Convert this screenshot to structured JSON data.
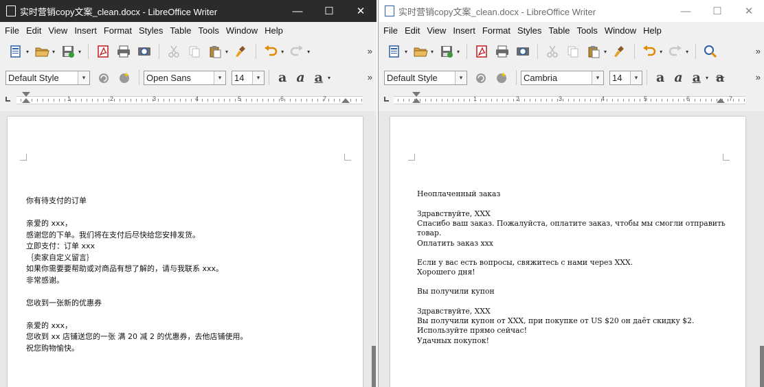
{
  "left_window": {
    "title": "实时营销copy文案_clean.docx - LibreOffice Writer",
    "menu": [
      "File",
      "Edit",
      "View",
      "Insert",
      "Format",
      "Styles",
      "Table",
      "Tools",
      "Window",
      "Help"
    ],
    "paragraph_style": "Default Style",
    "font_name": "Open Sans",
    "font_size": "14",
    "ruler_numbers": [
      "1",
      "2",
      "3",
      "4",
      "5",
      "6",
      "7"
    ],
    "doc_lines": [
      "你有待支付的订单",
      "亲爱的 xxx，",
      "  感谢您的下单。我们将在支付后尽快给您安排发货。",
      " 立即支付：订单 xxx",
      "  ｛卖家自定义留言｝",
      " 如果你需要要帮助或对商品有想了解的，请与我联系 xxx。",
      " 非常感谢。",
      "您收到一张新的优惠券",
      "亲爱的 xxx，",
      "   您收到 xx 店铺送您的一张 满 20 减 2 的优惠券，去他店铺使用。",
      "   祝您购物愉快。"
    ]
  },
  "right_window": {
    "title": "实时营销copy文案_clean.docx - LibreOffice Writer",
    "menu": [
      "File",
      "Edit",
      "View",
      "Insert",
      "Format",
      "Styles",
      "Table",
      "Tools",
      "Window",
      "Help"
    ],
    "paragraph_style": "Default Style",
    "font_name": "Cambria",
    "font_size": "14",
    "ruler_numbers": [
      "1",
      "2",
      "3",
      "4",
      "5",
      "6",
      "7"
    ],
    "doc_lines": [
      "Неоплаченный заказ",
      "Здравствуйте, XXX",
      "Спасибо ваш заказ. Пожалуйста, оплатите заказ, чтобы мы смогли отправить",
      "товар.",
      "Оплатить заказ xxx",
      "Если у вас есть вопросы, свяжитесь с нами через XXX.",
      "Хорошего дня!",
      "Вы получили купон",
      "Здравствуйте, XXX",
      "Вы получили купон от XXX, при покупке от US $20 он даёт скидку $2.",
      "Используйте прямо сейчас!",
      "Удачных покупок!"
    ]
  },
  "colors": {
    "titlebar_active": "#2b2b2b",
    "titlebar_inactive": "#ffffff",
    "chrome": "#f0f0f0",
    "doc_background": "#e8e8e8",
    "acrobat_red": "#c0191f",
    "save_green": "#3a9a3a",
    "undo_orange": "#e08a00"
  },
  "icons": {
    "window_controls": [
      "minimize-icon",
      "maximize-icon",
      "close-icon"
    ],
    "toolbar": [
      "new-document-icon",
      "open-folder-icon",
      "save-icon",
      "export-pdf-icon",
      "print-icon",
      "print-preview-icon",
      "cut-icon",
      "copy-icon",
      "paste-icon",
      "clone-formatting-icon",
      "undo-icon",
      "redo-icon",
      "find-replace-icon"
    ],
    "format": [
      "bold-icon",
      "italic-icon",
      "underline-icon",
      "strikethrough-icon"
    ],
    "glyphs": {
      "minimize": "—",
      "maximize": "☐",
      "close": "✕",
      "more": "»",
      "dropdown": "▾"
    }
  }
}
